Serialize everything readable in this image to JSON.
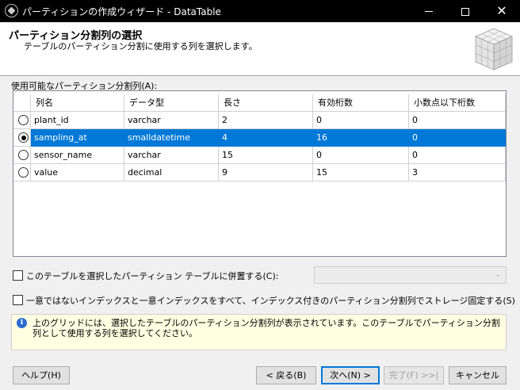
{
  "window": {
    "title": "パーティションの作成ウィザード - DataTable",
    "close_glyph": "✕"
  },
  "header": {
    "title": "パーティション分割列の選択",
    "subtitle": "テーブルのパーティション分割に使用する列を選択します。"
  },
  "columns_section": {
    "label": "使用可能なパーティション分割列(A):",
    "headers": [
      "列名",
      "データ型",
      "長さ",
      "有効桁数",
      "小数点以下桁数"
    ],
    "rows": [
      {
        "name": "plant_id",
        "type": "varchar",
        "length": "2",
        "precision": "0",
        "scale": "0",
        "selected": false
      },
      {
        "name": "sampling_at",
        "type": "smalldatetime",
        "length": "4",
        "precision": "16",
        "scale": "0",
        "selected": true
      },
      {
        "name": "sensor_name",
        "type": "varchar",
        "length": "15",
        "precision": "0",
        "scale": "0",
        "selected": false
      },
      {
        "name": "value",
        "type": "decimal",
        "length": "9",
        "precision": "15",
        "scale": "3",
        "selected": false
      }
    ]
  },
  "options": {
    "collocate_label": "このテーブルを選択したパーティション テーブルに併置する(C):",
    "collocate_checked": false,
    "collocate_combo_value": "",
    "storage_align_label": "一意ではないインデックスと一意インデックスをすべて、インデックス付きのパーティション分割列でストレージ固定する(S)",
    "storage_align_checked": false
  },
  "info": {
    "text": "上のグリッドには、選択したテーブルのパーティション分割列が表示されています。このテーブルでパーティション分割列として使用する列を選択してください。"
  },
  "buttons": {
    "help": "ヘルプ(H)",
    "back": "< 戻る(B)",
    "next": "次へ(N) >",
    "finish": "完了(F) >>|",
    "cancel": "キャンセル"
  }
}
